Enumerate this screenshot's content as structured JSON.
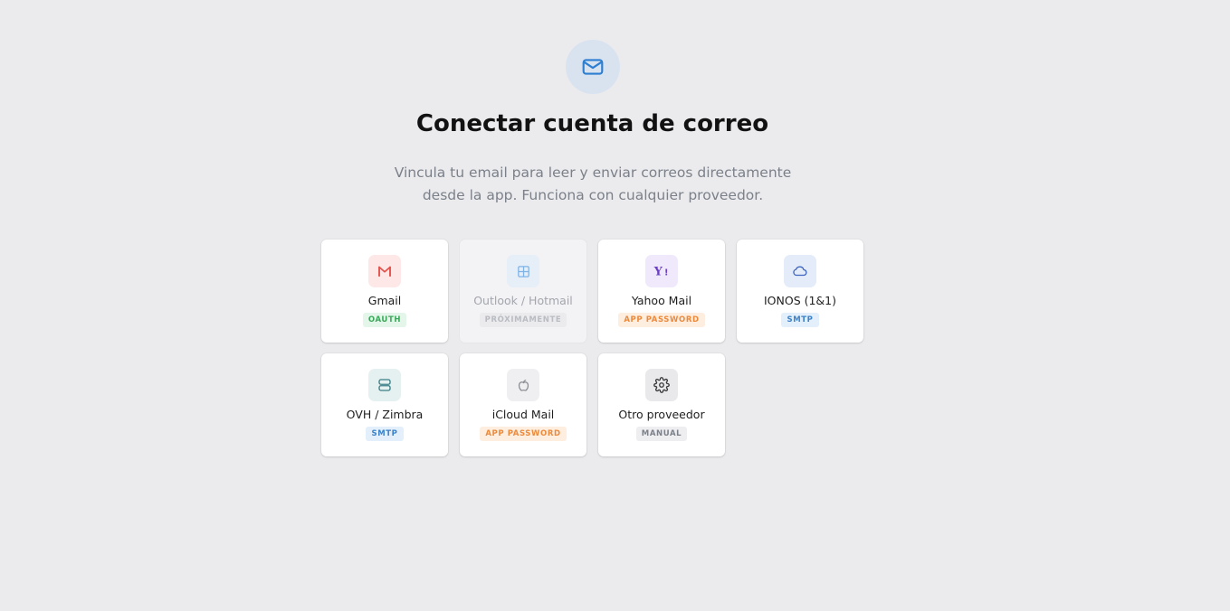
{
  "header": {
    "icon": "mail-icon",
    "title": "Conectar cuenta de correo",
    "subtitle_line1": "Vincula tu email para leer y enviar correos directamente",
    "subtitle_line2": "desde la app. Funciona con cualquier proveedor."
  },
  "providers": [
    {
      "label": "Gmail",
      "badge": "OAUTH",
      "icon": "gmail-icon",
      "icon_color": "#e2504a",
      "icon_bg": "#fde8e7"
    },
    {
      "label": "Outlook / Hotmail",
      "badge": "PRÓXIMAMENTE",
      "icon": "windows-icon",
      "icon_color": "#7fb3e6",
      "icon_bg": "#e6eef8",
      "disabled": true
    },
    {
      "label": "Yahoo Mail",
      "badge": "APP PASSWORD",
      "icon": "yahoo-icon",
      "icon_color": "#6b3fc4",
      "icon_bg": "#efe9fb"
    },
    {
      "label": "IONOS (1&1)",
      "badge": "SMTP",
      "icon": "cloud-icon",
      "icon_color": "#3e66c0",
      "icon_bg": "#e5ecf9"
    },
    {
      "label": "OVH / Zimbra",
      "badge": "SMTP",
      "icon": "server-icon",
      "icon_color": "#3b7f86",
      "icon_bg": "#e5f1f1"
    },
    {
      "label": "iCloud Mail",
      "badge": "APP PASSWORD",
      "icon": "apple-icon",
      "icon_color": "#8a8d92",
      "icon_bg": "#efeff1"
    },
    {
      "label": "Otro proveedor",
      "badge": "MANUAL",
      "icon": "gear-icon",
      "icon_color": "#3a3a3c",
      "icon_bg": "#e9e9eb"
    }
  ],
  "colors": {
    "background": "#ebebee",
    "accent": "#2e7fd1"
  }
}
